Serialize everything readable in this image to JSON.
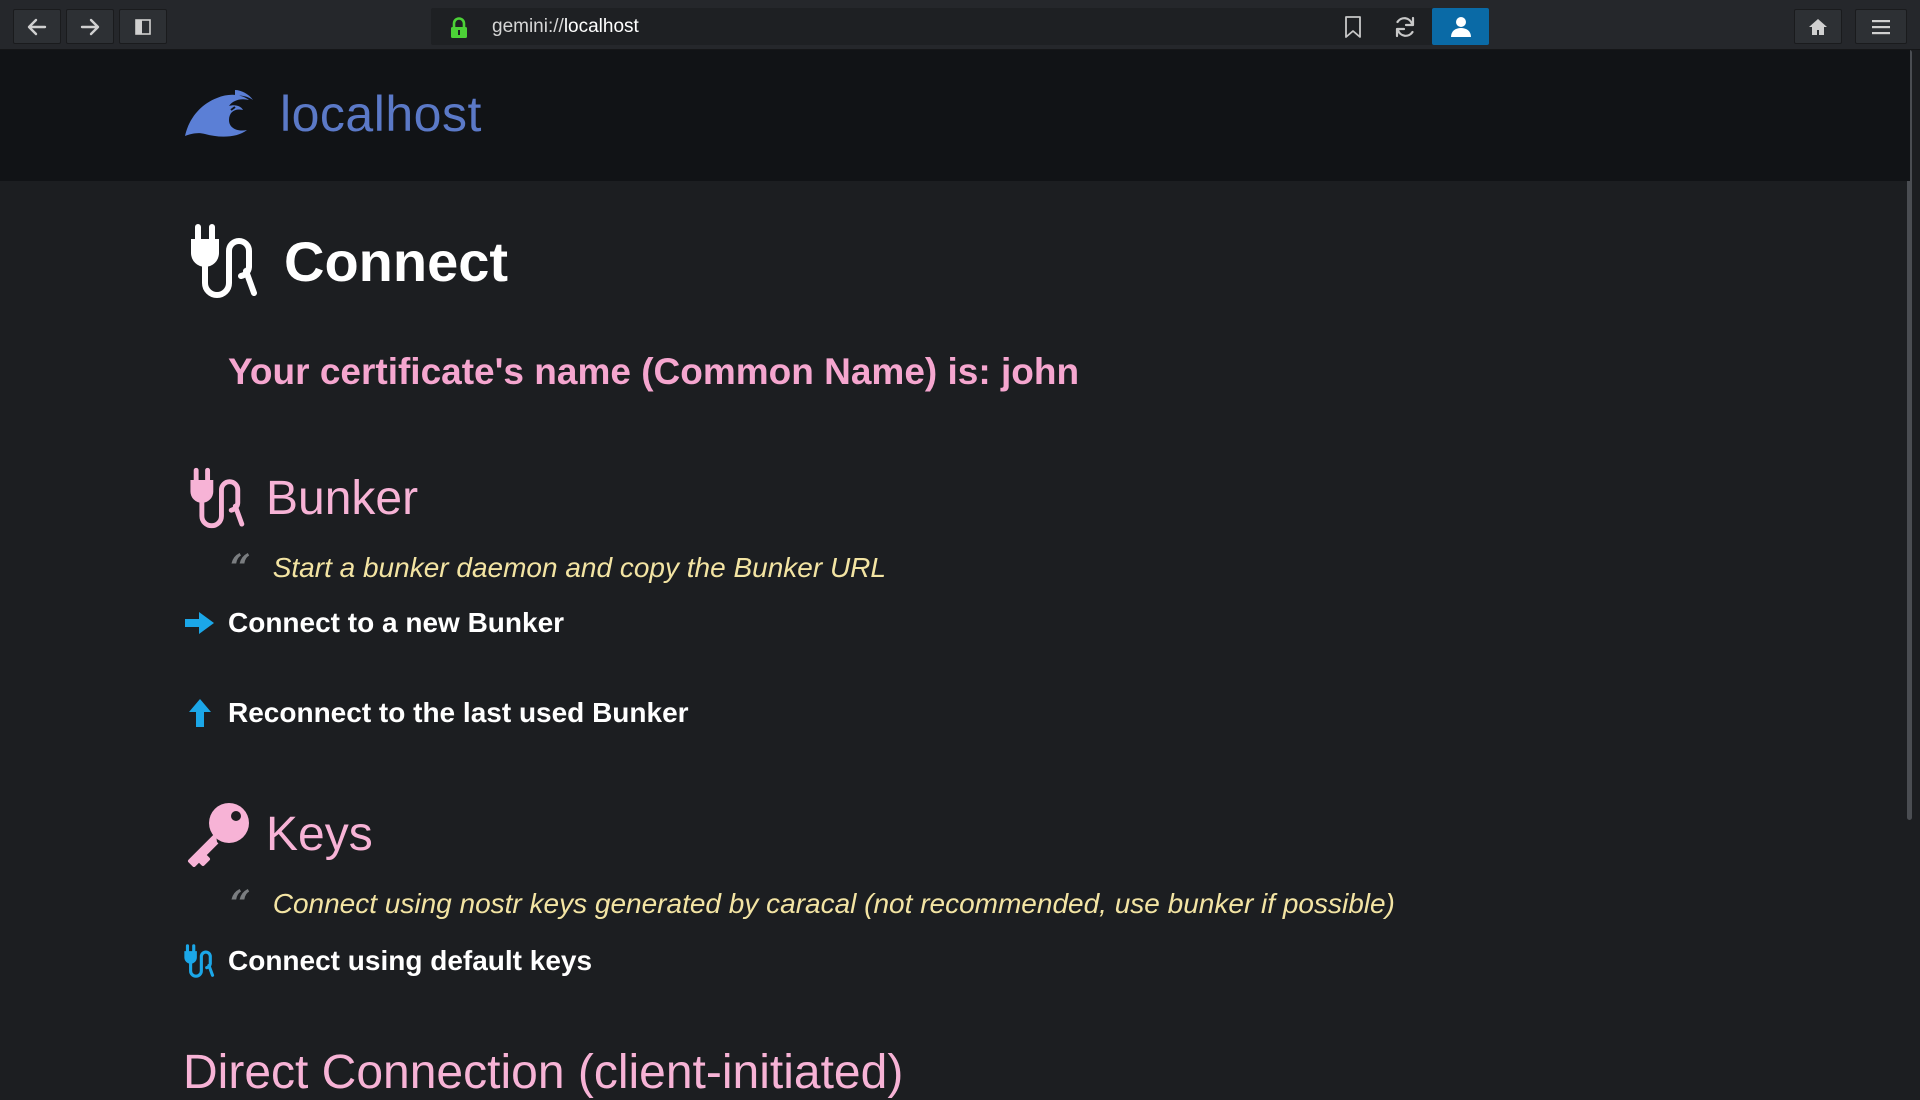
{
  "browser": {
    "url_scheme": "gemini://",
    "url_host": "localhost",
    "icons": {
      "back": "arrow-left-icon",
      "forward": "arrow-right-icon",
      "sidebar": "sidebar-icon",
      "lock": "lock-icon",
      "bookmark": "bookmark-icon",
      "reload": "reload-icon",
      "identity": "user-icon",
      "home": "home-icon",
      "menu": "hamburger-menu-icon"
    },
    "colors": {
      "lock": "#4cd137",
      "identity_bg": "#0a6aa6"
    }
  },
  "banner": {
    "site_name": "localhost",
    "logo_icon": "wave-icon",
    "colors": {
      "site_name": "#5b79c7",
      "logo": "#5b7fd6"
    }
  },
  "page": {
    "title": "Connect",
    "title_icon": "plug-icon",
    "certificate_line": "Your certificate's name (Common Name) is: john",
    "sections": [
      {
        "heading": "Bunker",
        "icon": "plug-icon",
        "quote": "Start a bunker daemon and copy the Bunker URL",
        "links": [
          {
            "label": "Connect to a new Bunker",
            "icon": "arrow-right-icon"
          },
          {
            "label": "Reconnect to the last used Bunker",
            "icon": "arrow-up-icon"
          }
        ]
      },
      {
        "heading": "Keys",
        "icon": "key-icon",
        "quote": "Connect using nostr keys generated by caracal (not recommended, use bunker if possible)",
        "links": [
          {
            "label": "Connect using default keys",
            "icon": "plug-icon"
          }
        ]
      }
    ],
    "next_heading": "Direct Connection (client-initiated)",
    "colors": {
      "heading": "#f7b3d6",
      "certificate": "#f5a6cf",
      "quote": "#f3e4a3",
      "link_icon": "#1ba7e8"
    }
  }
}
